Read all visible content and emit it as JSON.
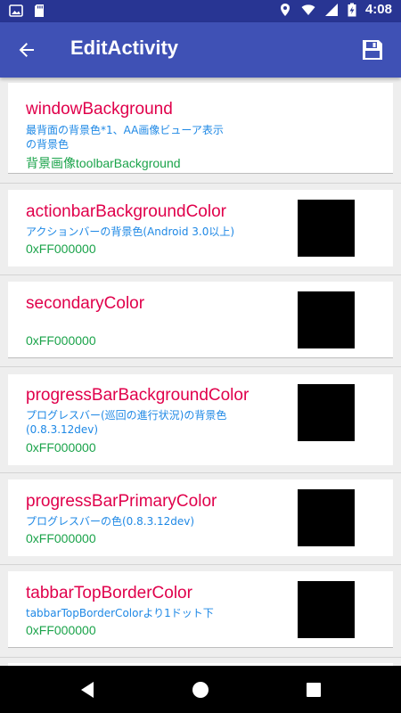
{
  "status_bar": {
    "time": "4:08",
    "icons": [
      "gallery-icon",
      "sd-card-icon",
      "location-icon",
      "wifi-icon",
      "signal-icon",
      "battery-charging-icon"
    ]
  },
  "app_bar": {
    "title": "EditActivity",
    "back_icon": "arrow-back-icon",
    "save_icon": "save-icon"
  },
  "items": [
    {
      "name": "windowBackground",
      "description": "最背面の背景色*1、AA画像ビューア表示の背景色",
      "value": "背景画像toolbarBackground",
      "has_swatch": false
    },
    {
      "name": "actionbarBackgroundColor",
      "description": "アクションバーの背景色(Android 3.0以上)",
      "value": "0xFF000000",
      "has_swatch": true,
      "swatch_color": "#000000"
    },
    {
      "name": "secondaryColor",
      "description": "",
      "value": "0xFF000000",
      "has_swatch": true,
      "swatch_color": "#000000"
    },
    {
      "name": "progressBarBackgroundColor",
      "description": "プログレスバー(巡回の進行状況)の背景色(0.8.3.12dev)",
      "value": "0xFF000000",
      "has_swatch": true,
      "swatch_color": "#000000"
    },
    {
      "name": "progressBarPrimaryColor",
      "description": "プログレスバーの色(0.8.3.12dev)",
      "value": "0xFF000000",
      "has_swatch": true,
      "swatch_color": "#000000"
    },
    {
      "name": "tabbarTopBorderColor",
      "description": "tabbarTopBorderColorより1ドット下",
      "value": "0xFF000000",
      "has_swatch": true,
      "swatch_color": "#000000"
    }
  ],
  "nav_bar": {
    "buttons": [
      "back-triangle-icon",
      "home-circle-icon",
      "recents-square-icon"
    ]
  },
  "colors": {
    "status_bar": "#283593",
    "app_bar": "#3f51b5",
    "name_text": "#e0004b",
    "desc_text": "#1e88e5",
    "value_text": "#1aa34a"
  }
}
